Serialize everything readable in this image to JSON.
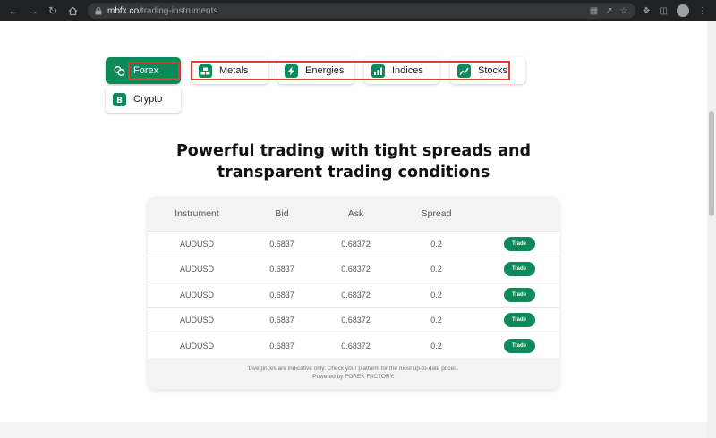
{
  "browser": {
    "url_host": "mbfx.co",
    "url_path": "/trading-instruments"
  },
  "tabs": [
    {
      "label": "Forex",
      "icon": "coins-icon",
      "active": true
    },
    {
      "label": "Metals",
      "icon": "bars-stack-icon",
      "active": false
    },
    {
      "label": "Energies",
      "icon": "lightning-icon",
      "active": false
    },
    {
      "label": "Indices",
      "icon": "bar-chart-icon",
      "active": false
    },
    {
      "label": "Stocks",
      "icon": "trend-line-icon",
      "active": false
    },
    {
      "label": "Crypto",
      "icon": "bitcoin-icon",
      "active": false
    }
  ],
  "headline": {
    "line1": "Powerful trading with tight spreads and",
    "line2": "transparent trading conditions"
  },
  "table": {
    "headers": [
      "Instrument",
      "Bid",
      "Ask",
      "Spread",
      ""
    ],
    "rows": [
      {
        "instrument": "AUDUSD",
        "bid": "0.6837",
        "ask": "0.68372",
        "spread": "0.2",
        "action": "Trade"
      },
      {
        "instrument": "AUDUSD",
        "bid": "0.6837",
        "ask": "0.68372",
        "spread": "0.2",
        "action": "Trade"
      },
      {
        "instrument": "AUDUSD",
        "bid": "0.6837",
        "ask": "0.68372",
        "spread": "0.2",
        "action": "Trade"
      },
      {
        "instrument": "AUDUSD",
        "bid": "0.6837",
        "ask": "0.68372",
        "spread": "0.2",
        "action": "Trade"
      },
      {
        "instrument": "AUDUSD",
        "bid": "0.6837",
        "ask": "0.68372",
        "spread": "0.2",
        "action": "Trade"
      }
    ],
    "note_line1": "Live prices are indicative only. Check your platform for the most up-to-date prices.",
    "note_line2": "Powered by FOREX FACTORY."
  },
  "colors": {
    "brand_green": "#0e8a5a",
    "highlight_red": "#e53935"
  }
}
